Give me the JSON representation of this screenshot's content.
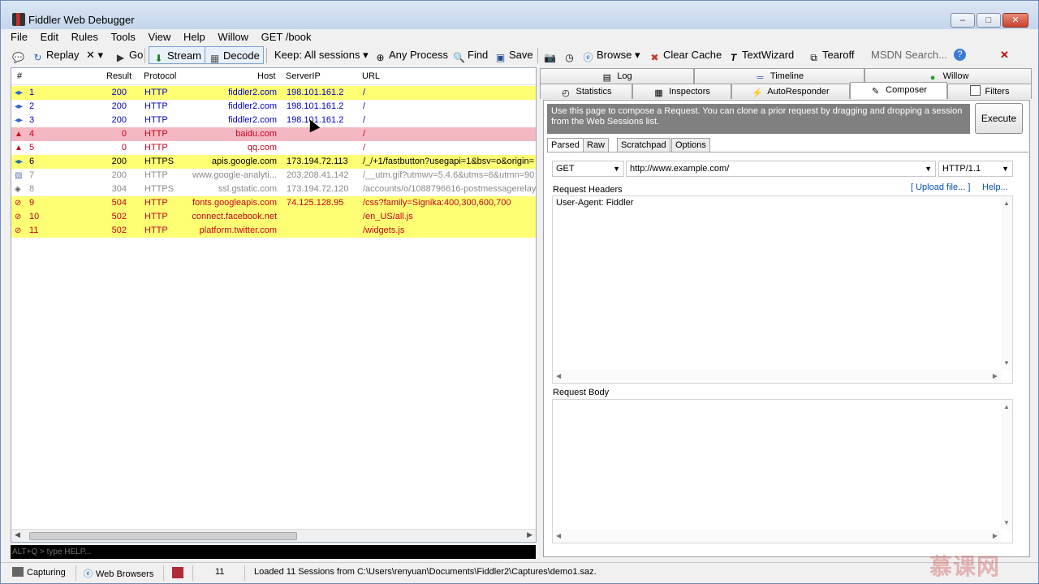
{
  "window": {
    "title": "Fiddler Web Debugger",
    "min": "‒",
    "max": "□",
    "close": "✕"
  },
  "menu": [
    "File",
    "Edit",
    "Rules",
    "Tools",
    "View",
    "Help",
    "Willow",
    "GET /book"
  ],
  "toolbar": {
    "comment": "",
    "replay": "Replay",
    "remove": "✕ ▾",
    "go": "Go",
    "stream": "Stream",
    "decode": "Decode",
    "keep": "Keep: All sessions ▾",
    "any_process": "Any Process",
    "find": "Find",
    "save": "Save",
    "browse": "Browse ▾",
    "clear_cache": "Clear Cache",
    "textwizard": "TextWizard",
    "tearoff": "Tearoff",
    "msdn_search": "MSDN Search...",
    "help": "?",
    "close": "✕"
  },
  "sessions": {
    "headers": {
      "num": "#",
      "result": "Result",
      "protocol": "Protocol",
      "host": "Host",
      "serverip": "ServerIP",
      "url": "URL"
    },
    "rows": [
      {
        "num": "1",
        "result": "200",
        "protocol": "HTTP",
        "host": "fiddler2.com",
        "ip": "198.101.161.2",
        "url": "/",
        "bg": "yellow",
        "fg": "blue",
        "icon": "arrows-icon"
      },
      {
        "num": "2",
        "result": "200",
        "protocol": "HTTP",
        "host": "fiddler2.com",
        "ip": "198.101.161.2",
        "url": "/",
        "bg": "white",
        "fg": "blue",
        "icon": "arrows-icon"
      },
      {
        "num": "3",
        "result": "200",
        "protocol": "HTTP",
        "host": "fiddler2.com",
        "ip": "198.101.161.2",
        "url": "/",
        "bg": "white",
        "fg": "blue",
        "icon": "arrows-icon"
      },
      {
        "num": "4",
        "result": "0",
        "protocol": "HTTP",
        "host": "baidu.com",
        "ip": "",
        "url": "/",
        "bg": "pink",
        "fg": "red",
        "icon": "warning-icon"
      },
      {
        "num": "5",
        "result": "0",
        "protocol": "HTTP",
        "host": "qq.com",
        "ip": "",
        "url": "/",
        "bg": "white",
        "fg": "red",
        "icon": "warning-icon"
      },
      {
        "num": "6",
        "result": "200",
        "protocol": "HTTPS",
        "host": "apis.google.com",
        "ip": "173.194.72.113",
        "url": "/_/+1/fastbutton?usegapi=1&bsv=o&origin=",
        "bg": "yellow",
        "fg": "black",
        "icon": "script-icon"
      },
      {
        "num": "7",
        "result": "200",
        "protocol": "HTTP",
        "host": "www.google-analyti...",
        "ip": "203.208.41.142",
        "url": "/__utm.gif?utmwv=5.4.6&utms=6&utmn=90",
        "bg": "white",
        "fg": "grey",
        "icon": "image-icon"
      },
      {
        "num": "8",
        "result": "304",
        "protocol": "HTTPS",
        "host": "ssl.gstatic.com",
        "ip": "173.194.72.120",
        "url": "/accounts/o/1088796616-postmessagerelay",
        "bg": "white",
        "fg": "grey",
        "icon": "diamond-icon"
      },
      {
        "num": "9",
        "result": "504",
        "protocol": "HTTP",
        "host": "fonts.googleapis.com",
        "ip": "74.125.128.95",
        "url": "/css?family=Signika:400,300,600,700",
        "bg": "yellow",
        "fg": "red",
        "icon": "blocked-icon"
      },
      {
        "num": "10",
        "result": "502",
        "protocol": "HTTP",
        "host": "connect.facebook.net",
        "ip": "",
        "url": "/en_US/all.js",
        "bg": "yellow",
        "fg": "red",
        "icon": "blocked-icon"
      },
      {
        "num": "11",
        "result": "502",
        "protocol": "HTTP",
        "host": "platform.twitter.com",
        "ip": "",
        "url": "/widgets.js",
        "bg": "yellow",
        "fg": "red",
        "icon": "blocked-icon"
      }
    ]
  },
  "quickexec": {
    "placeholder": "ALT+Q > type HELP..."
  },
  "tabs": {
    "log": "Log",
    "timeline": "Timeline",
    "willow": "Willow",
    "statistics": "Statistics",
    "inspectors": "Inspectors",
    "autoresponder": "AutoResponder",
    "composer": "Composer",
    "filters": "Filters"
  },
  "composer": {
    "info": "Use this page to compose a Request. You can clone a prior request by dragging and dropping a session from the Web Sessions list.",
    "execute": "Execute",
    "subtabs": [
      "Parsed",
      "Raw",
      "Scratchpad",
      "Options"
    ],
    "method": "GET",
    "url": "http://www.example.com/",
    "http_version": "HTTP/1.1",
    "request_headers_label": "Request Headers",
    "upload_link": "[ Upload file... ]",
    "help_link": "Help...",
    "headers_text": "User-Agent: Fiddler",
    "request_body_label": "Request Body"
  },
  "status": {
    "capturing": "Capturing",
    "process_filter": "Web Browsers",
    "count": "11",
    "message": "Loaded 11 Sessions from C:\\Users\\renyuan\\Documents\\Fiddler2\\Captures\\demo1.saz."
  },
  "watermark": "慕课网",
  "colors": {
    "yellow": "#ffff74",
    "pink": "#f4b8c3",
    "blue": "#0000c8",
    "red": "#c8001e",
    "grey": "#8a8a8a"
  }
}
